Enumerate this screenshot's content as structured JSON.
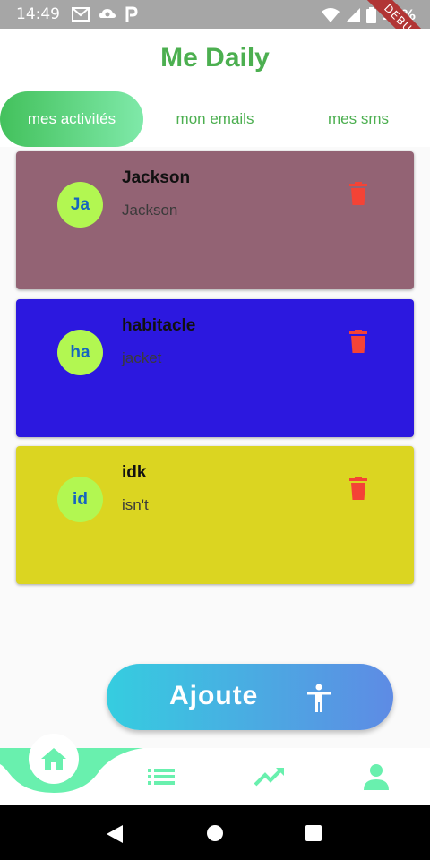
{
  "status_bar": {
    "time": "14:49",
    "battery": "99%",
    "debug_label": "DEBUG",
    "icons_left": [
      "gmail-icon",
      "cloud-icon",
      "p-icon"
    ],
    "icons_right": [
      "wifi-icon",
      "signal-icon",
      "battery-icon"
    ]
  },
  "app": {
    "title": "Me Daily",
    "accent": "#4caf50"
  },
  "tabs": [
    {
      "label": "mes activités",
      "active": true
    },
    {
      "label": "mon emails",
      "active": false
    },
    {
      "label": "mes sms",
      "active": false
    }
  ],
  "cards": [
    {
      "initials": "Ja",
      "title": "Jackson",
      "subtitle": "Jackson",
      "color": "#936374"
    },
    {
      "initials": "ha",
      "title": "habitacle",
      "subtitle": "jacket",
      "color": "#2c18df"
    },
    {
      "initials": "id",
      "title": "idk",
      "subtitle": "isn't",
      "color": "#dbd521"
    }
  ],
  "add_button": {
    "label": "Ajoute",
    "icon": "accessibility-icon"
  },
  "bottom_nav": {
    "items": [
      "home-icon",
      "list-icon",
      "trending-up-icon",
      "person-icon"
    ],
    "accent": "#69f0ae"
  }
}
